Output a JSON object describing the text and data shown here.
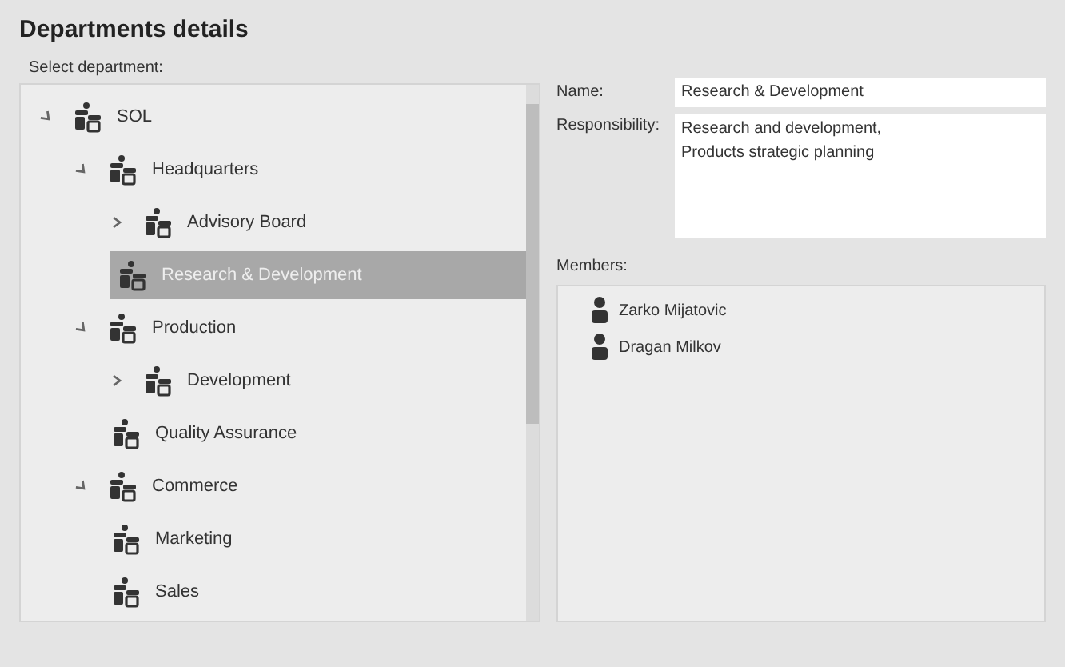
{
  "title": "Departments details",
  "tree": {
    "label": "Select department:",
    "items": [
      {
        "name": "SOL",
        "expanded": true,
        "selected": false,
        "children": [
          {
            "name": "Headquarters",
            "expanded": true,
            "selected": false,
            "children": [
              {
                "name": "Advisory Board",
                "expanded": false,
                "selected": false
              },
              {
                "name": "Research & Development",
                "selected": true
              }
            ]
          },
          {
            "name": "Production",
            "expanded": true,
            "selected": false,
            "children": [
              {
                "name": "Development",
                "expanded": false,
                "selected": false
              },
              {
                "name": "Quality Assurance",
                "selected": false
              }
            ]
          },
          {
            "name": "Commerce",
            "expanded": true,
            "selected": false,
            "children": [
              {
                "name": "Marketing",
                "selected": false
              },
              {
                "name": "Sales",
                "selected": false
              }
            ]
          }
        ]
      }
    ]
  },
  "details": {
    "name_label": "Name:",
    "name_value": "Research & Development",
    "responsibility_label": "Responsibility:",
    "responsibility_value": "Research and development,\nProducts strategic planning",
    "members_label": "Members:",
    "members": [
      {
        "name": "Zarko Mijatovic"
      },
      {
        "name": "Dragan Milkov"
      }
    ]
  }
}
